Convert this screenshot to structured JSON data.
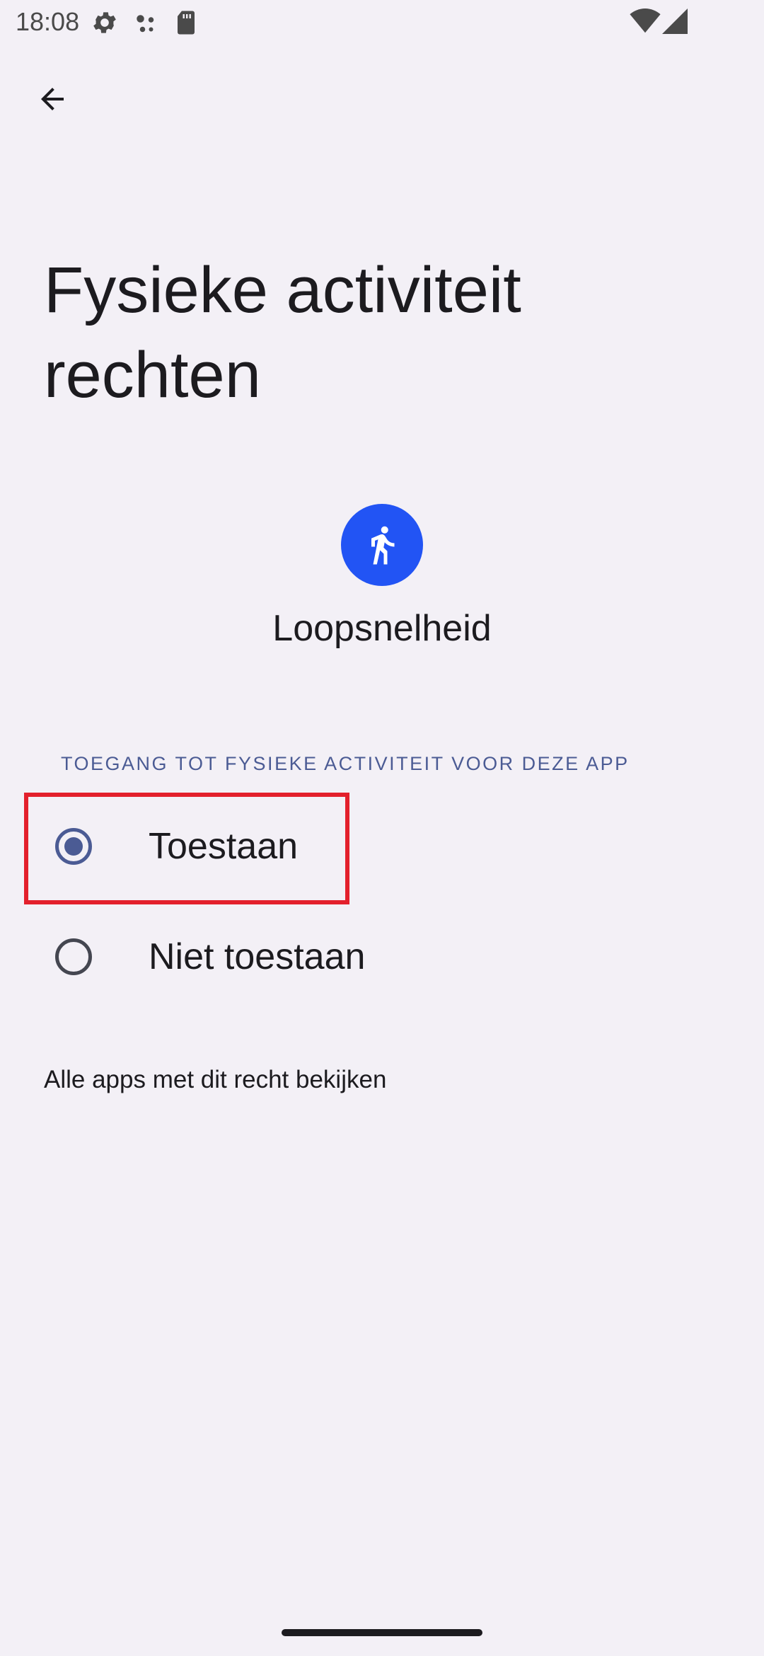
{
  "status_bar": {
    "time": "18:08",
    "icons_left": [
      "settings-gear-icon",
      "assistant-dots-icon",
      "sd-card-icon"
    ],
    "icons_right": [
      "wifi-icon",
      "cell-signal-icon"
    ]
  },
  "header": {
    "back_icon": "arrow-back-icon"
  },
  "page": {
    "title": "Fysieke activiteit rechten"
  },
  "app": {
    "name": "Loopsnelheid",
    "icon": "walking-person-icon",
    "icon_color": "#2254f4"
  },
  "permission": {
    "section_header": "TOEGANG TOT FYSIEKE ACTIVITEIT VOOR DEZE APP",
    "options": [
      {
        "label": "Toestaan",
        "selected": true
      },
      {
        "label": "Niet toestaan",
        "selected": false
      }
    ]
  },
  "footer": {
    "all_apps_link": "Alle apps met dit recht bekijken"
  },
  "colors": {
    "background": "#f3f0f6",
    "accent": "#4b5b94",
    "highlight": "#e3202c"
  }
}
